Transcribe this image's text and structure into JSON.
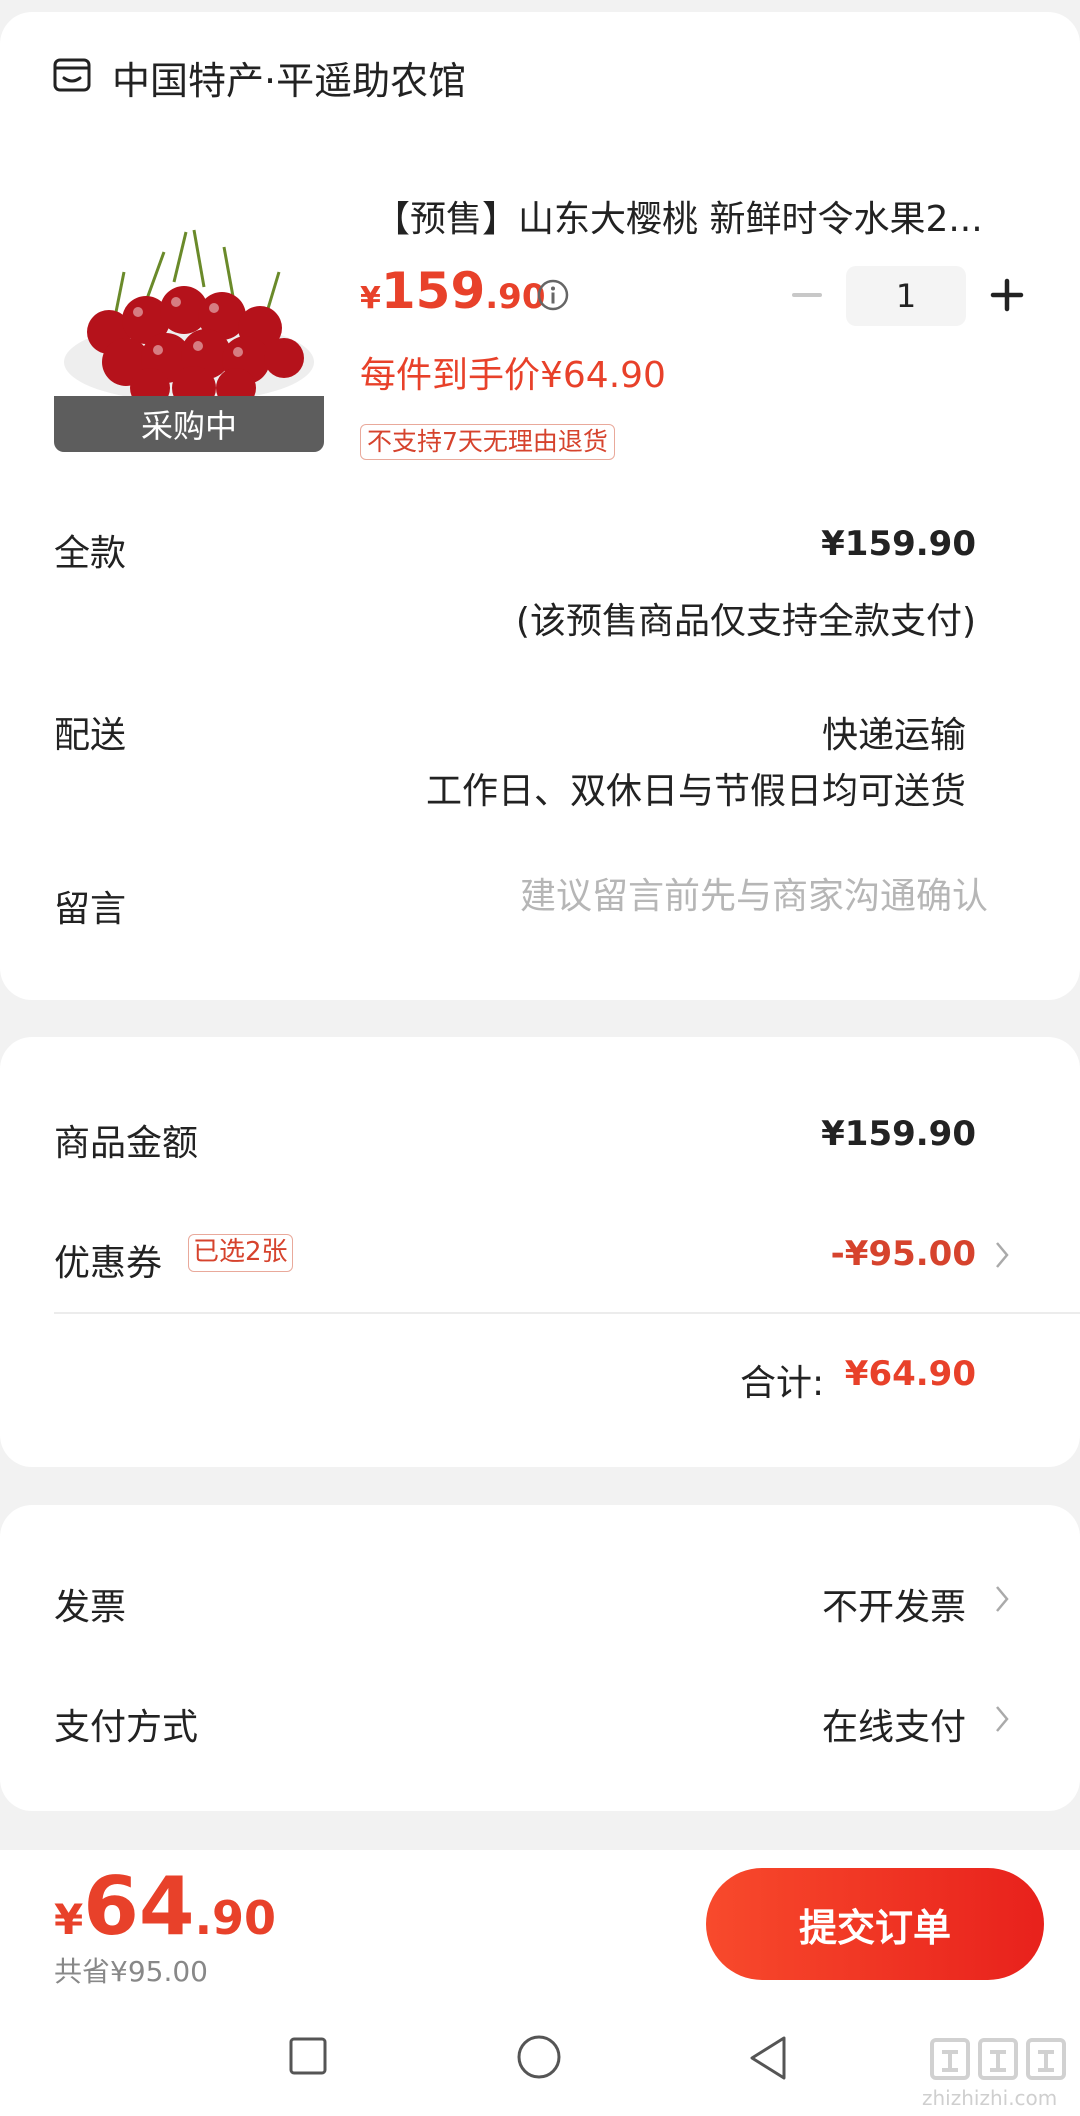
{
  "shop": {
    "icon": "shop-icon",
    "name": "中国特产·平遥助农馆"
  },
  "product": {
    "title": "【预售】山东大樱桃 新鲜时令水果2...",
    "badge": "采购中",
    "price_symbol": "¥",
    "price_int": "159",
    "price_dec": ".90",
    "unit_price": "每件到手价¥64.90",
    "return_tag": "不支持7天无理由退货",
    "quantity": "1",
    "minus_label": "−",
    "plus_label": "+"
  },
  "payment_full": {
    "label": "全款",
    "value": "¥159.90",
    "note": "(该预售商品仅支持全款支付)"
  },
  "delivery": {
    "label": "配送",
    "value": "快递运输",
    "note": "工作日、双休日与节假日均可送货"
  },
  "message": {
    "label": "留言",
    "placeholder": "建议留言前先与商家沟通确认"
  },
  "amount": {
    "goods_label": "商品金额",
    "goods_value": "¥159.90",
    "coupon_label": "优惠券",
    "coupon_badge": "已选2张",
    "coupon_value": "-¥95.00",
    "total_label": "合计:",
    "total_value": "¥64.90"
  },
  "invoice": {
    "label": "发票",
    "value": "不开发票"
  },
  "pay_method": {
    "label": "支付方式",
    "value": "在线支付"
  },
  "footer": {
    "price_symbol": "¥",
    "price_int": "64",
    "price_dec": ".90",
    "saved": "共省¥95.00",
    "submit": "提交订单"
  },
  "watermark": {
    "text": "zhizhizhi.com"
  },
  "colors": {
    "accent": "#e8412a",
    "button": "#f04326",
    "badge_bg": "#5d5d5d"
  }
}
